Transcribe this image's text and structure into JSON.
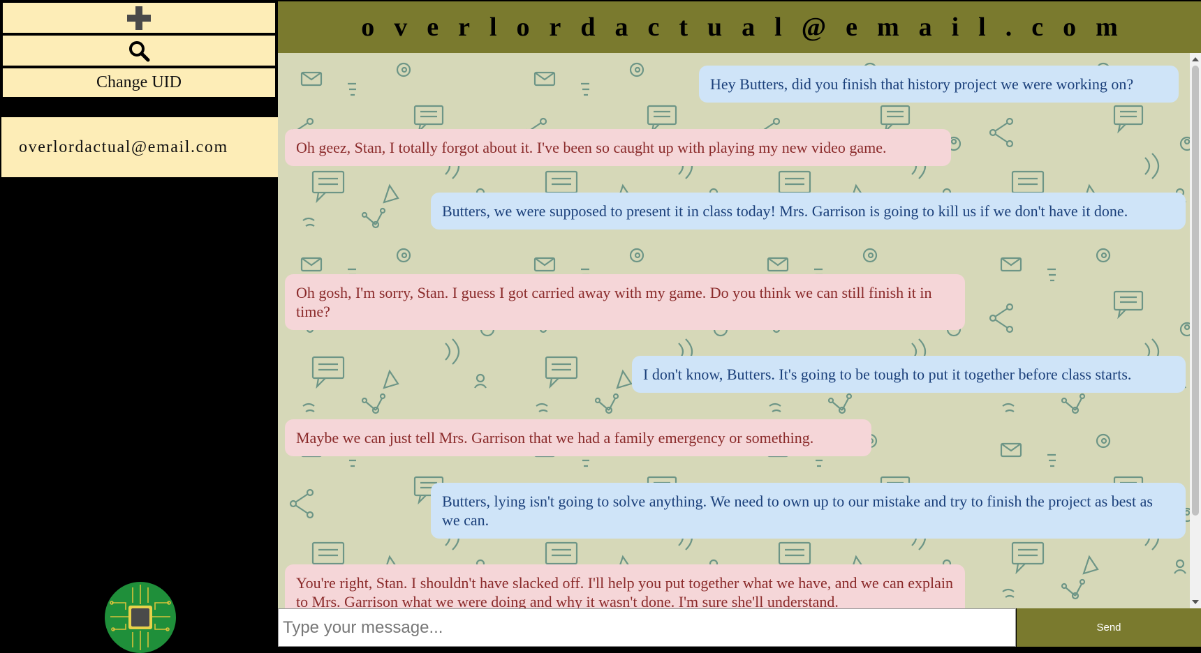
{
  "sidebar": {
    "add_icon": "plus-icon",
    "search_icon": "search-icon",
    "change_uid_label": "Change UID",
    "contacts": [
      {
        "label": "overlordactual@email.com"
      }
    ],
    "logo_icon": "circuit-chip-icon"
  },
  "header": {
    "title": "overlordactual@email.com"
  },
  "messages": [
    {
      "side": "sent",
      "text": "Hey Butters, did you finish that history project we were working on?"
    },
    {
      "side": "recv",
      "text": "Oh geez, Stan, I totally forgot about it. I've been so caught up with playing my new video game."
    },
    {
      "side": "sent",
      "text": "Butters, we were supposed to present it in class today! Mrs. Garrison is going to kill us if we don't have it done."
    },
    {
      "side": "recv",
      "text": "Oh gosh, I'm sorry, Stan. I guess I got carried away with my game. Do you think we can still finish it in time?"
    },
    {
      "side": "sent",
      "text": "I don't know, Butters. It's going to be tough to put it together before class starts."
    },
    {
      "side": "recv",
      "text": "Maybe we can just tell Mrs. Garrison that we had a family emergency or something."
    },
    {
      "side": "sent",
      "text": "Butters, lying isn't going to solve anything. We need to own up to our mistake and try to finish the project as best as we can."
    },
    {
      "side": "recv",
      "text": "You're right, Stan. I shouldn't have slacked off. I'll help you put together what we have, and we can explain to Mrs. Garrison what we were doing and why it wasn't done. I'm sure she'll understand."
    }
  ],
  "composer": {
    "placeholder": "Type your message...",
    "send_label": "Send"
  },
  "colors": {
    "header_bg": "#7a7a2e",
    "sidebar_item_bg": "#fdedb7",
    "sent_bubble": "#cfe4f8",
    "recv_bubble": "#f5d6d8"
  }
}
